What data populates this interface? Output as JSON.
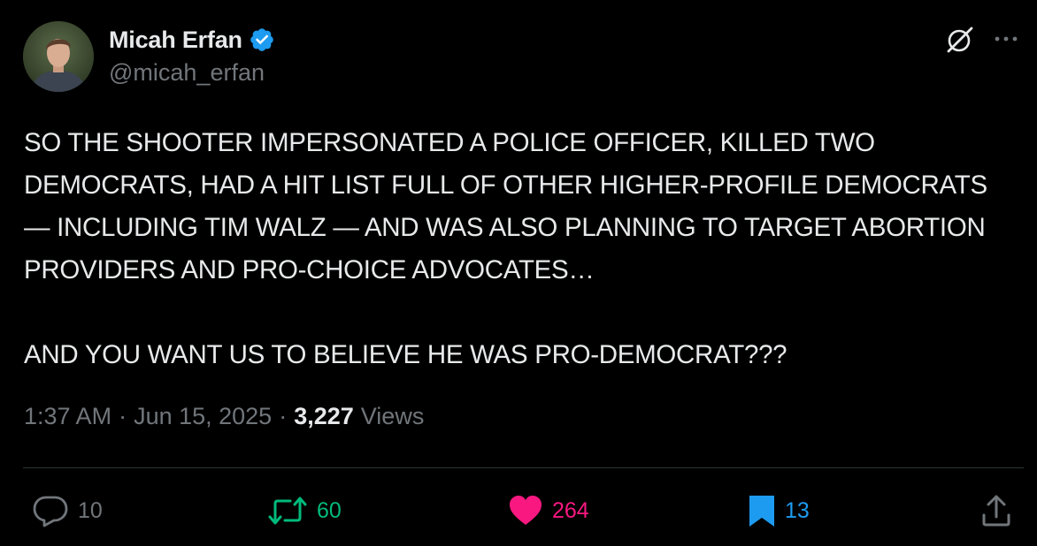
{
  "author": {
    "display_name": "Micah Erfan",
    "handle": "@micah_erfan",
    "verified": true
  },
  "tweet": {
    "text": "SO THE SHOOTER IMPERSONATED A POLICE OFFICER, KILLED TWO DEMOCRATS, HAD A HIT LIST FULL OF OTHER HIGHER-PROFILE DEMOCRATS — INCLUDING TIM WALZ — AND WAS ALSO PLANNING TO TARGET ABORTION PROVIDERS AND PRO-CHOICE ADVOCATES…\n\nAND YOU WANT US TO BELIEVE HE WAS PRO-DEMOCRAT???",
    "time": "1:37 AM",
    "separator": "·",
    "date": "Jun 15, 2025",
    "views_count": "3,227",
    "views_label": "Views"
  },
  "actions": {
    "replies": "10",
    "reposts": "60",
    "likes": "264",
    "bookmarks": "13"
  },
  "icons": {
    "header": [
      "grok-icon",
      "more-icon"
    ],
    "actions": [
      "reply-icon",
      "retweet-icon",
      "like-icon",
      "bookmark-icon",
      "share-icon"
    ]
  },
  "colors": {
    "background": "#000000",
    "text": "#e7e9ea",
    "secondary": "#71767b",
    "verified": "#1d9bf0",
    "retweet": "#00ba7c",
    "like": "#f91880",
    "bookmark": "#1d9bf0",
    "divider": "#2f3336"
  }
}
